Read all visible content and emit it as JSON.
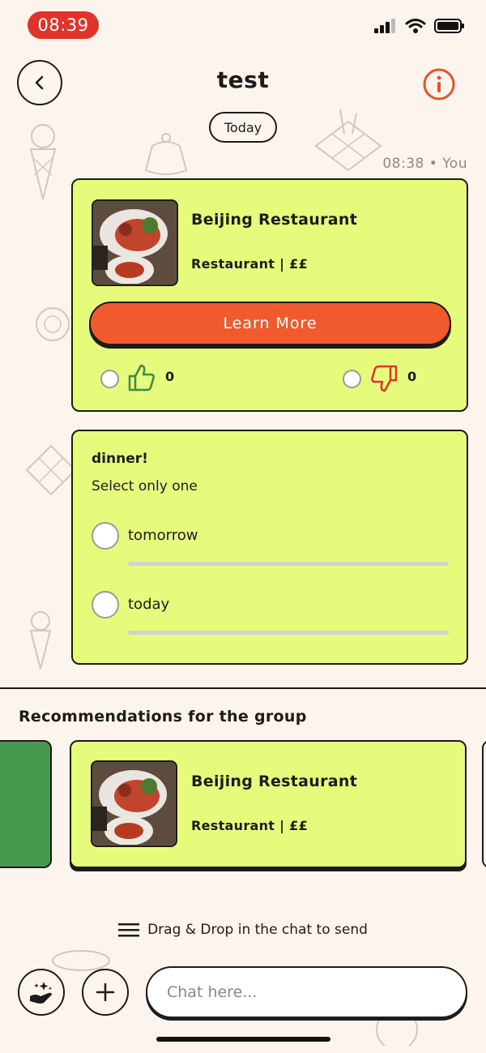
{
  "status_bar": {
    "time": "08:39"
  },
  "header": {
    "title": "test"
  },
  "chat": {
    "date_label": "Today",
    "message_meta": "08:38 • You",
    "restaurant_card": {
      "name": "Beijing Restaurant",
      "meta": "Restaurant | ££",
      "button_label": "Learn More",
      "like_count": "0",
      "dislike_count": "0"
    },
    "poll": {
      "title": "dinner!",
      "subtitle": "Select only one",
      "options": [
        {
          "label": "tomorrow"
        },
        {
          "label": "today"
        }
      ]
    }
  },
  "recommendations": {
    "title": "Recommendations for the group",
    "cards": [
      {
        "name": "Beijing Restaurant",
        "meta": "Restaurant | ££"
      }
    ]
  },
  "composer": {
    "drag_hint": "Drag & Drop in the chat to send",
    "placeholder": "Chat here..."
  },
  "colors": {
    "accent_orange": "#f05a2c",
    "card_lime": "#e6fa7c",
    "card_green": "#47994f",
    "status_red": "#e2332b",
    "info_orange": "#e8542a",
    "dislike_red": "#e2332b",
    "like_green": "#3e8a3e"
  }
}
